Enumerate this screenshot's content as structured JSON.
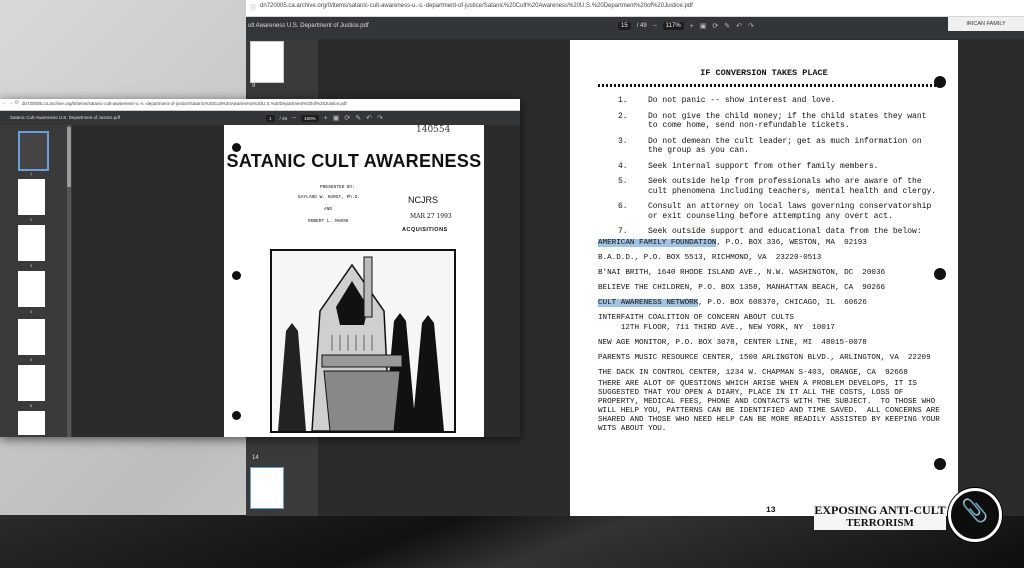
{
  "back_window": {
    "url": "dn720005.ca.archive.org/0/items/satanic-cult-awareness-u.-s.-department-of-justice/Satanic%20Cult%20Awareness%20U.S.%20Department%20of%20Justice.pdf",
    "title": "ult Awareness U.S. Department of Justice.pdf",
    "page_current": "15",
    "page_total": "/ 49",
    "zoom": "117%",
    "bookmark": "IRICAN FAMILY FOUNDATION",
    "thumb_labels": [
      "9",
      "14"
    ],
    "page": {
      "heading": "IF CONVERSION TAKES PLACE",
      "items": [
        {
          "n": "1.",
          "text": "Do not panic -- show interest and love."
        },
        {
          "n": "2.",
          "text": "Do not give the child money; if the child states they want to come home, send non-refundable tickets."
        },
        {
          "n": "3.",
          "text": "Do not demean the cult leader; get as much information on the group as you can."
        },
        {
          "n": "4.",
          "text": "Seek internal support from other family members."
        },
        {
          "n": "5.",
          "text": "Seek outside help from professionals who are aware of the cult phenomena including teachers, mental health and clergy."
        },
        {
          "n": "6.",
          "text": "Consult an attorney on local laws governing conservatorship or exit counseling before attempting any overt act."
        },
        {
          "n": "7.",
          "text": "Seek outside support and educational data from the below:"
        }
      ],
      "addr1_hl": "AMERICAN FAMILY FOUNDATION",
      "addr1_rest": ", P.O. BOX 336, WESTON, MA  02193",
      "addr2": "B.A.D.D., P.O. BOX 5513, RICHMOND, VA  23220-0513",
      "addr3": "B'NAI BRITH, 1640 RHODE ISLAND AVE., N.W. WASHINGTON, DC  20036",
      "addr4": "BELIEVE THE CHILDREN, P.O. BOX 1358, MANHATTAN BEACH, CA  90266",
      "addr5_hl": "CULT AWARENESS NETWORK",
      "addr5_rest": ", P.O. BOX 608370, CHICAGO, IL  60626",
      "addr6": "INTERFAITH COALITION OF CONCERN ABOUT CULTS\n     12TH FLOOR, 711 THIRD AVE., NEW YORK, NY  10017",
      "addr7": "NEW AGE MONITOR, P.O. BOX 3078, CENTER LINE, MI  48015-0078",
      "addr8": "PARENTS MUSIC RESOURCE CENTER, 1500 ARLINGTON BLVD., ARLINGTON, VA  22209",
      "addr9": "THE DACK IN CONTROL CENTER, 1234 W. CHAPMAN S-403, ORANGE, CA  92668",
      "closing": "THERE ARE ALOT OF QUESTIONS WHICH ARISE WHEN A PROBLEM DEVELOPS, IT IS\nSUGGESTED THAT YOU OPEN A DIARY, PLACE IN IT ALL THE COSTS, LOSS OF\nPROPERTY, MEDICAL FEES, PHONE AND CONTACTS WITH THE SUBJECT.  TO THOSE WHO\nWILL HELP YOU, PATTERNS CAN BE IDENTIFIED AND TIME SAVED.  ALL CONCERNS ARE\nSHARED AND THOSE WHO NEED HELP CAN BE MORE READILY ASSISTED BY KEEPING YOUR\nWITS ABOUT YOU.",
      "page_number": "13"
    }
  },
  "front_window": {
    "url": "dn720005.ca.archive.org/0/items/satanic-cult-awareness-u.-s.-department-of-justice/Satanic%20Cult%20Awareness%20U.S.%20Department%20of%20Justice.pdf",
    "title": "Satanic Cult Awareness U.S. Department of Justice.pdf",
    "page_current": "1",
    "page_total": "/ 49",
    "zoom": "100%",
    "thumb_labels": [
      "1",
      "2",
      "3",
      "4",
      "5",
      "6"
    ],
    "page": {
      "stamp": "140554",
      "title": "SATANIC CULT AWARENESS",
      "presented_by": "PRESENTED BY:",
      "author1": "GAYLAND W. HURST, Ph.D.",
      "and": "AND",
      "author2": "ROBERT L. MARSH",
      "ncjrs": "NCJRS",
      "date": "MAR 27 1993",
      "acquisitions": "ACQUISITIONS"
    }
  },
  "branding": {
    "line1": "EXPOSING ANTI-CULT",
    "line2": "TERRORISM"
  }
}
